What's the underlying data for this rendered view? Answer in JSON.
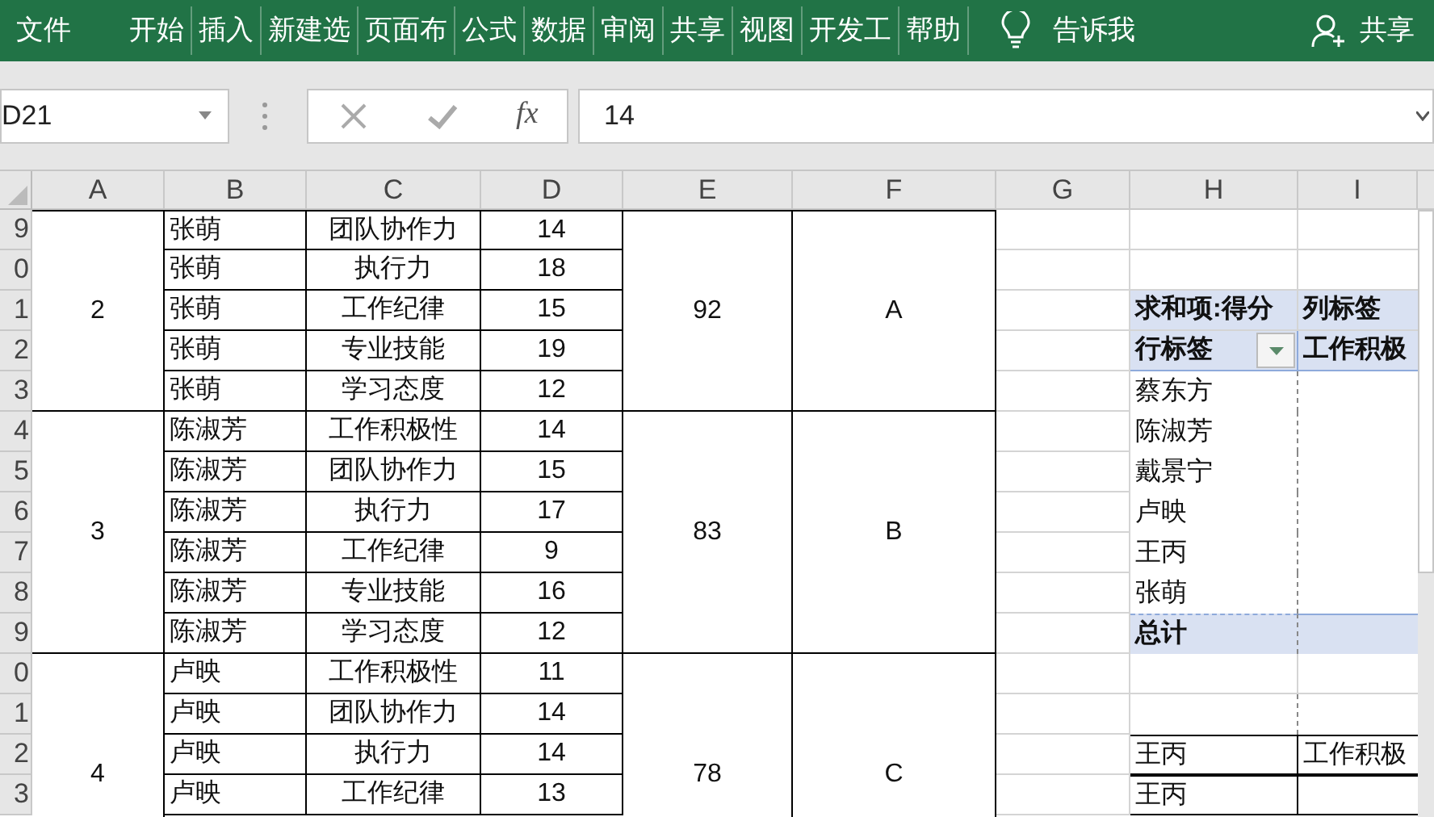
{
  "ribbon": {
    "tabs": [
      {
        "kind": "file",
        "label": "文件"
      },
      {
        "kind": "tab",
        "label": "开始"
      },
      {
        "kind": "tab",
        "label": "插入"
      },
      {
        "kind": "tab",
        "label": "新建选"
      },
      {
        "kind": "tab",
        "label": "页面布"
      },
      {
        "kind": "tab",
        "label": "公式"
      },
      {
        "kind": "tab",
        "label": "数据"
      },
      {
        "kind": "tab",
        "label": "审阅"
      },
      {
        "kind": "tab",
        "label": "共享"
      },
      {
        "kind": "tab",
        "label": "视图"
      },
      {
        "kind": "tab",
        "label": "开发工"
      },
      {
        "kind": "tab",
        "label": "帮助"
      }
    ],
    "tell_me": "告诉我",
    "share": "共享"
  },
  "formula_bar": {
    "name_box": "D21",
    "function_button": "fx",
    "value": "14"
  },
  "columns": [
    "A",
    "B",
    "C",
    "D",
    "E",
    "F",
    "G",
    "H",
    "I"
  ],
  "row_numbers": [
    "9",
    "0",
    "1",
    "2",
    "3",
    "4",
    "5",
    "6",
    "7",
    "8",
    "9",
    "0",
    "1",
    "2",
    "3"
  ],
  "groups": [
    {
      "rank": "2",
      "total": "92",
      "grade": "A",
      "continues": false,
      "rows": [
        {
          "name": "张萌",
          "item": "团队协作力",
          "score": "14"
        },
        {
          "name": "张萌",
          "item": "执行力",
          "score": "18"
        },
        {
          "name": "张萌",
          "item": "工作纪律",
          "score": "15"
        },
        {
          "name": "张萌",
          "item": "专业技能",
          "score": "19"
        },
        {
          "name": "张萌",
          "item": "学习态度",
          "score": "12"
        }
      ]
    },
    {
      "rank": "3",
      "total": "83",
      "grade": "B",
      "continues": false,
      "rows": [
        {
          "name": "陈淑芳",
          "item": "工作积极性",
          "score": "14"
        },
        {
          "name": "陈淑芳",
          "item": "团队协作力",
          "score": "15"
        },
        {
          "name": "陈淑芳",
          "item": "执行力",
          "score": "17"
        },
        {
          "name": "陈淑芳",
          "item": "工作纪律",
          "score": "9"
        },
        {
          "name": "陈淑芳",
          "item": "专业技能",
          "score": "16"
        },
        {
          "name": "陈淑芳",
          "item": "学习态度",
          "score": "12"
        }
      ]
    },
    {
      "rank": "4",
      "total": "78",
      "grade": "C",
      "continues": true,
      "rows": [
        {
          "name": "卢映",
          "item": "工作积极性",
          "score": "11"
        },
        {
          "name": "卢映",
          "item": "团队协作力",
          "score": "14"
        },
        {
          "name": "卢映",
          "item": "执行力",
          "score": "14"
        },
        {
          "name": "卢映",
          "item": "工作纪律",
          "score": "13"
        }
      ]
    }
  ],
  "pivot": {
    "value_field": "求和项:得分",
    "column_label": "列标签",
    "row_label": "行标签",
    "column_item": "工作积极",
    "items": [
      "蔡东方",
      "陈淑芳",
      "戴景宁",
      "卢映",
      "王丙",
      "张萌"
    ],
    "grand_total": "总计"
  },
  "extra_rows": [
    {
      "name": "王丙",
      "item": "工作积极"
    },
    {
      "name": "王丙"
    }
  ]
}
